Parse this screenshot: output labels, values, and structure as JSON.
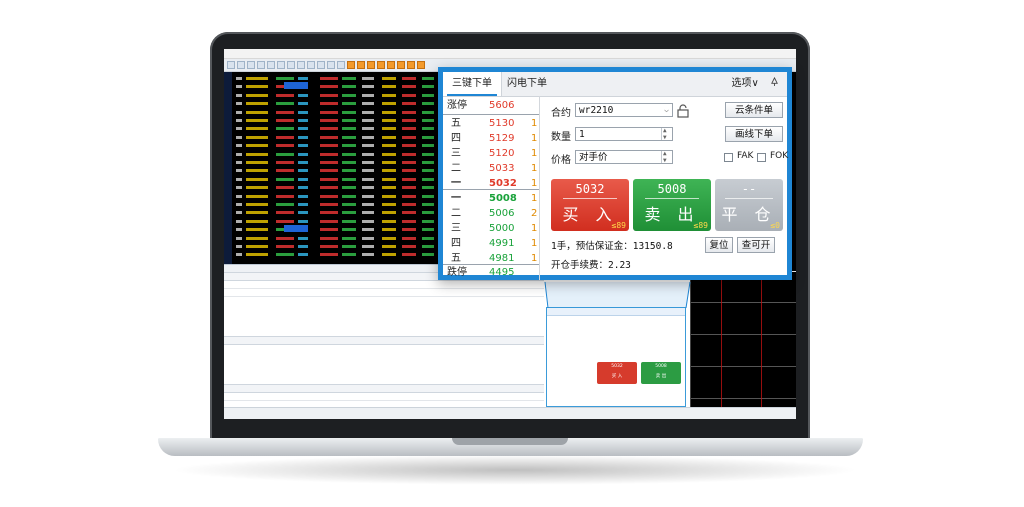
{
  "zoom_panel": {
    "tabs": [
      "三键下单",
      "闪电下单"
    ],
    "options_label": "选项",
    "options_arrow": "∨",
    "pin_icon": "pin",
    "book": {
      "limit_up_label": "涨停",
      "limit_up_price": "5606",
      "asks": [
        {
          "level": "五",
          "price": "5130",
          "qty": "1"
        },
        {
          "level": "四",
          "price": "5129",
          "qty": "1"
        },
        {
          "level": "三",
          "price": "5120",
          "qty": "1"
        },
        {
          "level": "二",
          "price": "5033",
          "qty": "1"
        },
        {
          "level": "一",
          "price": "5032",
          "qty": "1"
        }
      ],
      "bids": [
        {
          "level": "一",
          "price": "5008",
          "qty": "1"
        },
        {
          "level": "二",
          "price": "5006",
          "qty": "2"
        },
        {
          "level": "三",
          "price": "5000",
          "qty": "1"
        },
        {
          "level": "四",
          "price": "4991",
          "qty": "1"
        },
        {
          "level": "五",
          "price": "4981",
          "qty": "1"
        }
      ],
      "limit_down_label": "跌停",
      "limit_down_price": "4495"
    },
    "form": {
      "contract_label": "合约",
      "contract_value": "wr2210",
      "qty_label": "数量",
      "qty_value": "1",
      "price_label": "价格",
      "price_value": "对手价",
      "cloud_btn": "云条件单",
      "line_btn": "画线下单",
      "fak_label": "FAK",
      "fok_label": "FOK",
      "buy": {
        "price": "5032",
        "action": "买 入",
        "count": "≤89"
      },
      "sell": {
        "price": "5008",
        "action": "卖 出",
        "count": "≤89"
      },
      "close": {
        "price": "--",
        "action": "平 仓",
        "count": "≤0"
      },
      "margin_text": "1手，预估保证金：13150.8",
      "reset_btn": "复位",
      "open_btn": "查可开",
      "fee_text": "开仓手续费：2.23"
    }
  },
  "mini_panel": {
    "buy_price": "5032",
    "buy_action": "买 入",
    "sell_price": "5008",
    "sell_action": "卖 出"
  }
}
